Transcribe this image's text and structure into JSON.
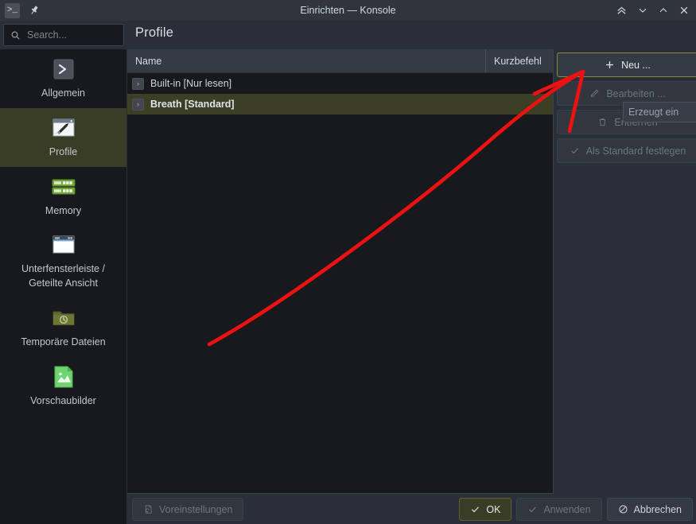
{
  "window": {
    "title": "Einrichten — Konsole",
    "app_icon": "konsole-icon",
    "pin_icon": "pin-icon",
    "controls": [
      {
        "name": "keep-above-button",
        "glyph": "«"
      },
      {
        "name": "minimize-button",
        "glyph": "⌄"
      },
      {
        "name": "maximize-button",
        "glyph": "⌃"
      },
      {
        "name": "close-button",
        "glyph": "✕"
      }
    ]
  },
  "search": {
    "placeholder": "Search...",
    "value": "",
    "icon": "search-icon"
  },
  "header": {
    "page_title": "Profile"
  },
  "sidebar": {
    "items": [
      {
        "label": "Allgemein",
        "icon": "terminal-prompt-icon",
        "selected": false
      },
      {
        "label": "Profile",
        "icon": "pencil-window-icon",
        "selected": true
      },
      {
        "label": "Memory",
        "icon": "memory-module-icon",
        "selected": false
      },
      {
        "label": "Unterfensterleiste / Geteilte Ansicht",
        "icon": "split-window-icon",
        "selected": false
      },
      {
        "label": "Temporäre Dateien",
        "icon": "folder-clock-icon",
        "selected": false
      },
      {
        "label": "Vorschaubilder",
        "icon": "image-preview-icon",
        "selected": false
      }
    ]
  },
  "profile_list": {
    "columns": [
      {
        "key": "name",
        "label": "Name"
      },
      {
        "key": "shortcut",
        "label": "Kurzbefehl"
      }
    ],
    "rows": [
      {
        "name": "Built-in [Nur lesen]",
        "shortcut": "",
        "selected": false,
        "expander": "›"
      },
      {
        "name": "Breath [Standard]",
        "shortcut": "",
        "selected": true,
        "expander": "›"
      }
    ]
  },
  "actions": [
    {
      "label": "Neu ...",
      "icon": "plus-icon",
      "state": "focus"
    },
    {
      "label": "Bearbeiten ...",
      "icon": "pencil-icon",
      "state": "disabled"
    },
    {
      "label": "Entfernen",
      "icon": "trash-icon",
      "state": "disabled"
    },
    {
      "label": "Als Standard festlegen",
      "icon": "check-icon",
      "state": "disabled"
    }
  ],
  "tooltip": {
    "text": "Erzeugt ein"
  },
  "footer": {
    "defaults": {
      "label": "Voreinstellungen",
      "icon": "document-revert-icon",
      "state": "disabled"
    },
    "ok": {
      "label": "OK",
      "icon": "check-icon",
      "state": "default"
    },
    "apply": {
      "label": "Anwenden",
      "icon": "check-icon",
      "state": "disabled"
    },
    "cancel": {
      "label": "Abbrechen",
      "icon": "cancel-icon",
      "state": "normal"
    }
  },
  "annotation": {
    "color": "#ee1111",
    "shape": "arrow-pointing-to-neu-button"
  },
  "colors": {
    "window_bg": "#2a2e38",
    "panel_bg": "#17191c",
    "titlebar_bg": "#2f343d",
    "selection_olive": "#3c3e26",
    "header_row_bg": "#353b45",
    "text": "#cfd5dc",
    "text_disabled": "#6d757f",
    "focus_border": "#8a8b3a",
    "annotation_red": "#ee1111"
  }
}
